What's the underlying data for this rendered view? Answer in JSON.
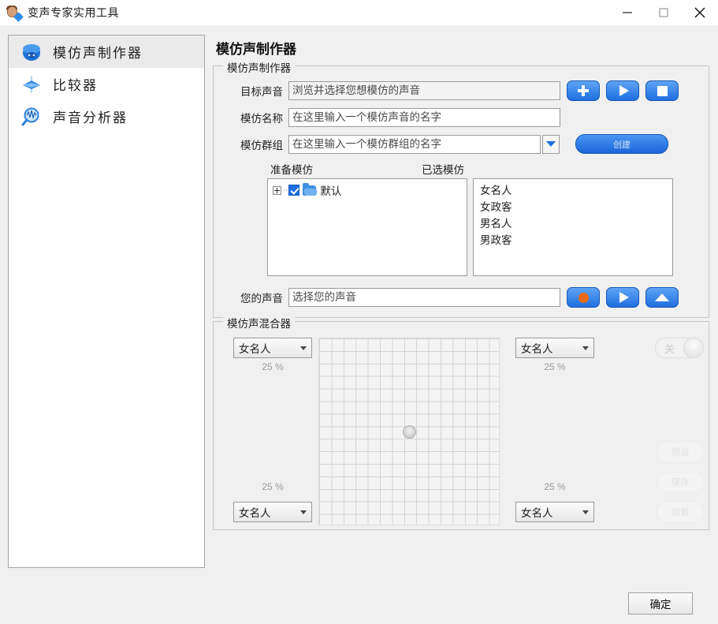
{
  "window": {
    "title": "变声专家实用工具",
    "app_icon": "avatar-gem-icon",
    "minimize": "minimize-icon",
    "maximize": "maximize-icon",
    "close": "close-icon"
  },
  "sidebar": {
    "items": [
      {
        "label": "模仿声制作器",
        "icon": "voice-morph-icon",
        "active": true
      },
      {
        "label": "比较器",
        "icon": "comparator-icon",
        "active": false
      },
      {
        "label": "声音分析器",
        "icon": "analyzer-magnifier-icon",
        "active": false
      }
    ]
  },
  "main": {
    "page_title": "模仿声制作器",
    "morpher_group": {
      "legend": "模仿声制作器",
      "target_voice": {
        "label": "目标声音",
        "value": "浏览并选择您想模仿的声音"
      },
      "morph_name": {
        "label": "模仿名称",
        "value": "在这里输入一个模仿声音的名字"
      },
      "morph_group": {
        "label": "模仿群组",
        "value": "在这里输入一个模仿群组的名字"
      },
      "create_button": "创建",
      "buttons": {
        "add": "add-icon",
        "play": "play-icon",
        "stop": "stop-icon"
      },
      "lists": {
        "available_label": "准备模仿",
        "selected_label": "已选模仿",
        "tree_node": "默认",
        "selected_items": [
          "女名人",
          "女政客",
          "男名人",
          "男政客"
        ]
      },
      "your_voice": {
        "label": "您的声音",
        "value": "选择您的声音"
      },
      "voice_buttons": {
        "record": "record-icon",
        "play": "play-icon",
        "eject": "eject-icon"
      }
    },
    "mixer_group": {
      "legend": "模仿声混合器",
      "slots": [
        {
          "position": "top-left",
          "value": "女名人",
          "percent": "25 %"
        },
        {
          "position": "top-right",
          "value": "女名人",
          "percent": "25 %"
        },
        {
          "position": "bottom-left",
          "value": "女名人",
          "percent": "25 %"
        },
        {
          "position": "bottom-right",
          "value": "女名人",
          "percent": "25 %"
        }
      ],
      "toggle": {
        "label": "关"
      },
      "actions": [
        "预设",
        "保存",
        "加载"
      ]
    }
  },
  "footer": {
    "ok_button": "确定"
  },
  "colors": {
    "accent_blue": "#1e6fe0",
    "record_orange": "#eb6a10",
    "window_bg": "#f0f0f0",
    "panel_white": "#ffffff"
  }
}
